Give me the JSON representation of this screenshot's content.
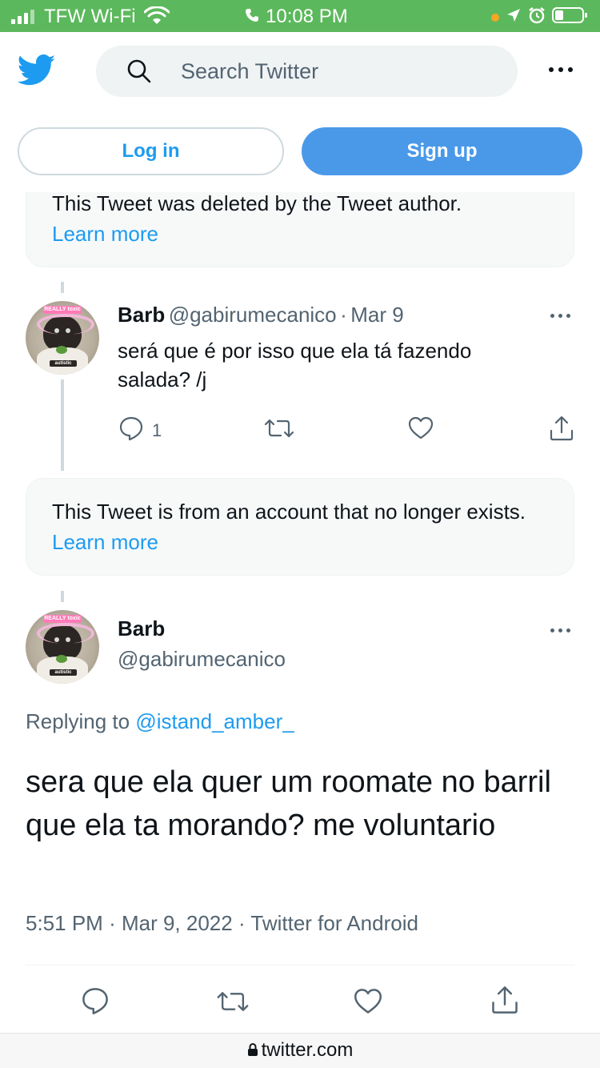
{
  "status_bar": {
    "carrier": "TFW Wi-Fi",
    "time": "10:08 PM"
  },
  "header": {
    "search_placeholder": "Search Twitter",
    "login_label": "Log in",
    "signup_label": "Sign up"
  },
  "notice_deleted": {
    "text": "This Tweet was deleted by the Tweet author.",
    "link": "Learn more"
  },
  "reply_tweet": {
    "name": "Barb",
    "handle": "@gabirumecanico",
    "separator": "·",
    "date": "Mar 9",
    "text": "será que é por isso que ela tá fazendo salada? /j",
    "reply_count": "1"
  },
  "notice_missing": {
    "text": "This Tweet is from an account that no longer exists.",
    "link": "Learn more"
  },
  "avatar": {
    "top_tag": "REALLY toxic",
    "bottom_tag": "autistic"
  },
  "main_tweet": {
    "name": "Barb",
    "handle": "@gabirumecanico",
    "replying_prefix": "Replying to",
    "replying_to": "@istand_amber_",
    "text": "sera que ela quer um roomate no barril que ela ta morando? me voluntario",
    "time": "5:51 PM",
    "dot1": "·",
    "date": "Mar 9, 2022",
    "dot2": "·",
    "source": "Twitter for Android"
  },
  "browser": {
    "url": "twitter.com"
  },
  "colors": {
    "status_bar": "#5cb85c",
    "accent": "#1d9bf0",
    "signup_bg": "#4a99e9",
    "muted_text": "#536471"
  }
}
